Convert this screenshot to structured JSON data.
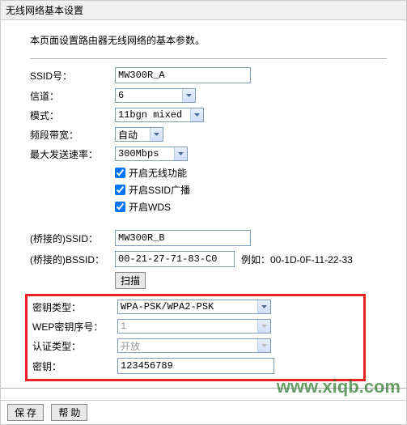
{
  "panel_title": "无线网络基本设置",
  "desc": "本页面设置路由器无线网络的基本参数。",
  "labels": {
    "ssid": "SSID号：",
    "channel": "信道：",
    "mode": "模式：",
    "bandwidth": "频段带宽：",
    "maxrate": "最大发送速率：",
    "bridge_ssid": "(桥接的)SSID：",
    "bridge_bssid": "(桥接的)BSSID：",
    "key_type": "密钥类型：",
    "wep_index": "WEP密钥序号：",
    "auth_type": "认证类型：",
    "key": "密钥："
  },
  "values": {
    "ssid": "MW300R_A",
    "channel": "6",
    "mode": "11bgn mixed",
    "bandwidth": "自动",
    "maxrate": "300Mbps",
    "bridge_ssid": "MW300R_B",
    "bridge_bssid": "00-21-27-71-83-C0",
    "bssid_example": "例如：00-1D-0F-11-22-33",
    "key_type": "WPA-PSK/WPA2-PSK",
    "wep_index": "1",
    "auth_type": "开放",
    "key": "123456789"
  },
  "checkboxes": {
    "enable_wireless": {
      "label": "开启无线功能",
      "checked": true
    },
    "enable_ssid_broadcast": {
      "label": "开启SSID广播",
      "checked": true
    },
    "enable_wds": {
      "label": "开启WDS",
      "checked": true
    }
  },
  "buttons": {
    "scan": "扫描",
    "save": "保 存",
    "help": "帮 助"
  },
  "watermark": "www.xiqb.com"
}
